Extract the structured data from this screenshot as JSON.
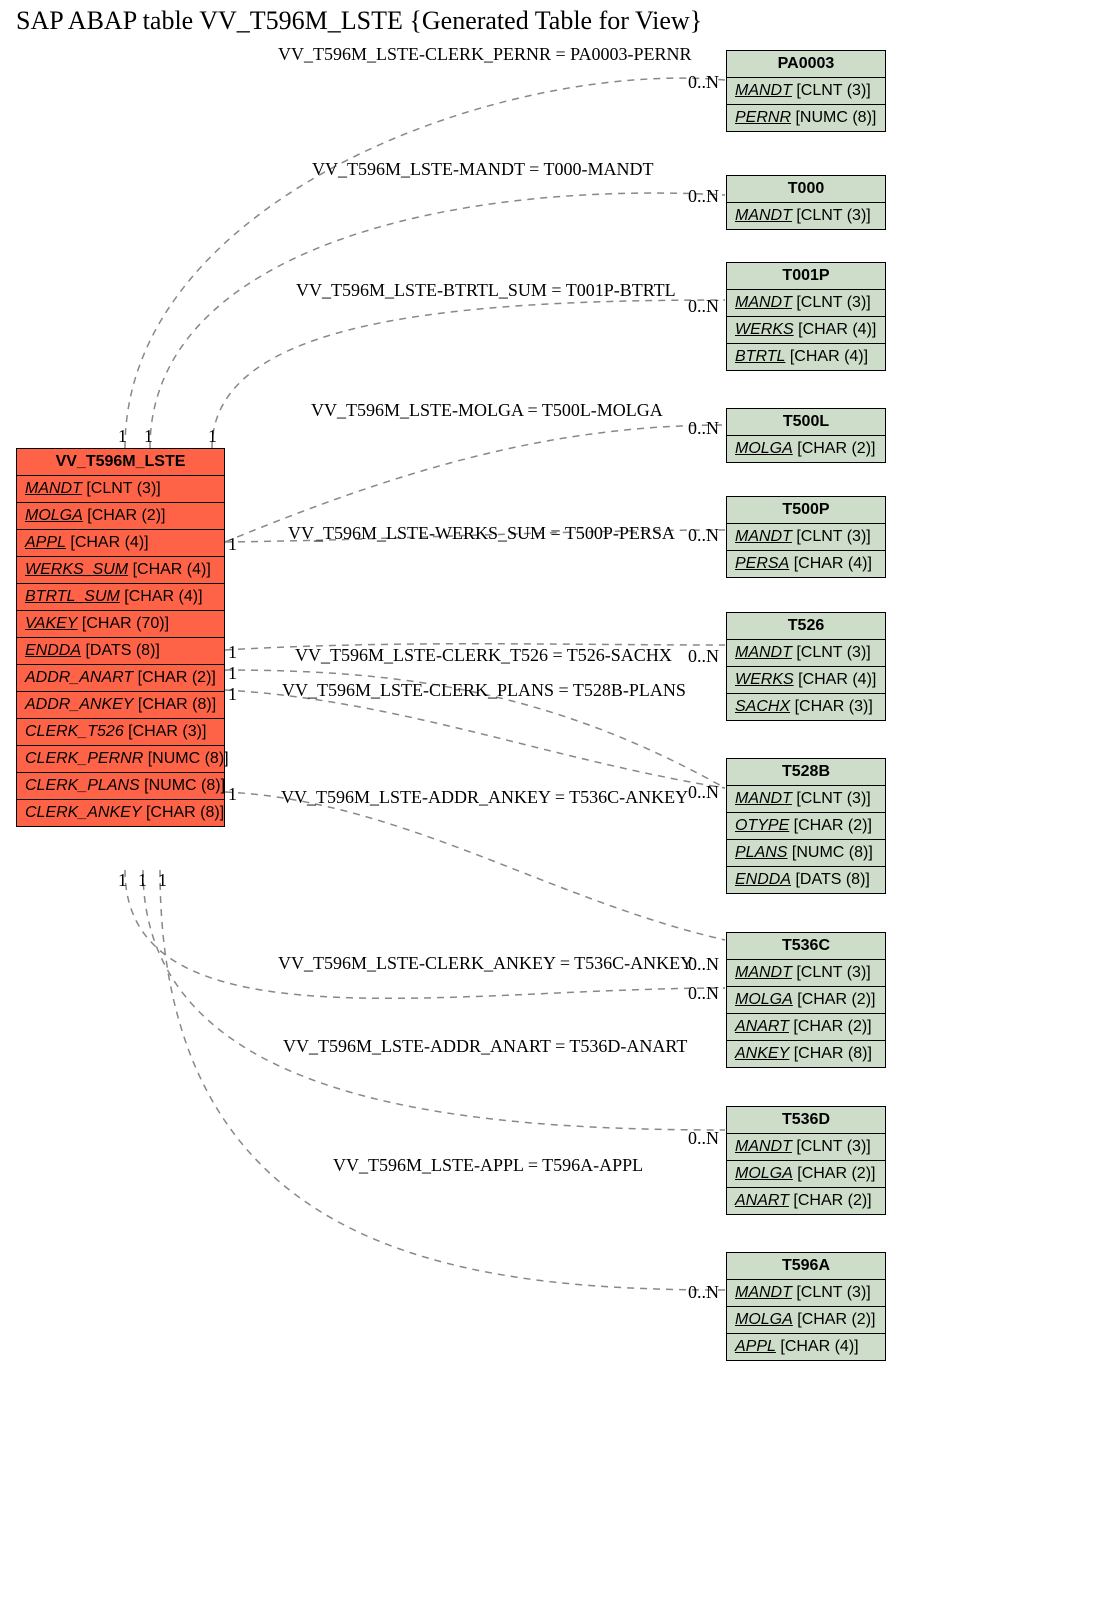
{
  "title": "SAP ABAP table VV_T596M_LSTE {Generated Table for View}",
  "main": {
    "name": "VV_T596M_LSTE",
    "fields": [
      {
        "name": "MANDT",
        "type": "[CLNT (3)]",
        "u": 1
      },
      {
        "name": "MOLGA",
        "type": "[CHAR (2)]",
        "u": 1
      },
      {
        "name": "APPL",
        "type": "[CHAR (4)]",
        "u": 1
      },
      {
        "name": "WERKS_SUM",
        "type": "[CHAR (4)]",
        "u": 1
      },
      {
        "name": "BTRTL_SUM",
        "type": "[CHAR (4)]",
        "u": 1
      },
      {
        "name": "VAKEY",
        "type": "[CHAR (70)]",
        "u": 1
      },
      {
        "name": "ENDDA",
        "type": "[DATS (8)]",
        "u": 1
      },
      {
        "name": "ADDR_ANART",
        "type": "[CHAR (2)]"
      },
      {
        "name": "ADDR_ANKEY",
        "type": "[CHAR (8)]"
      },
      {
        "name": "CLERK_T526",
        "type": "[CHAR (3)]"
      },
      {
        "name": "CLERK_PERNR",
        "type": "[NUMC (8)]"
      },
      {
        "name": "CLERK_PLANS",
        "type": "[NUMC (8)]"
      },
      {
        "name": "CLERK_ANKEY",
        "type": "[CHAR (8)]"
      }
    ]
  },
  "rels": [
    {
      "name": "PA0003",
      "fields": [
        {
          "name": "MANDT",
          "type": "[CLNT (3)]",
          "u": 1
        },
        {
          "name": "PERNR",
          "type": "[NUMC (8)]",
          "u": 1
        }
      ]
    },
    {
      "name": "T000",
      "fields": [
        {
          "name": "MANDT",
          "type": "[CLNT (3)]",
          "u": 1
        }
      ]
    },
    {
      "name": "T001P",
      "fields": [
        {
          "name": "MANDT",
          "type": "[CLNT (3)]",
          "u": 1
        },
        {
          "name": "WERKS",
          "type": "[CHAR (4)]",
          "u": 1
        },
        {
          "name": "BTRTL",
          "type": "[CHAR (4)]",
          "u": 1
        }
      ]
    },
    {
      "name": "T500L",
      "fields": [
        {
          "name": "MOLGA",
          "type": "[CHAR (2)]",
          "u": 1
        }
      ]
    },
    {
      "name": "T500P",
      "fields": [
        {
          "name": "MANDT",
          "type": "[CLNT (3)]",
          "u": 1
        },
        {
          "name": "PERSA",
          "type": "[CHAR (4)]",
          "u": 1
        }
      ]
    },
    {
      "name": "T526",
      "fields": [
        {
          "name": "MANDT",
          "type": "[CLNT (3)]",
          "u": 1
        },
        {
          "name": "WERKS",
          "type": "[CHAR (4)]",
          "u": 1
        },
        {
          "name": "SACHX",
          "type": "[CHAR (3)]",
          "u": 1
        }
      ]
    },
    {
      "name": "T528B",
      "fields": [
        {
          "name": "MANDT",
          "type": "[CLNT (3)]",
          "u": 1
        },
        {
          "name": "OTYPE",
          "type": "[CHAR (2)]",
          "u": 1
        },
        {
          "name": "PLANS",
          "type": "[NUMC (8)]",
          "u": 1
        },
        {
          "name": "ENDDA",
          "type": "[DATS (8)]",
          "u": 1
        }
      ]
    },
    {
      "name": "T536C",
      "fields": [
        {
          "name": "MANDT",
          "type": "[CLNT (3)]",
          "u": 1
        },
        {
          "name": "MOLGA",
          "type": "[CHAR (2)]",
          "u": 1
        },
        {
          "name": "ANART",
          "type": "[CHAR (2)]",
          "u": 1
        },
        {
          "name": "ANKEY",
          "type": "[CHAR (8)]",
          "u": 1
        }
      ]
    },
    {
      "name": "T536D",
      "fields": [
        {
          "name": "MANDT",
          "type": "[CLNT (3)]",
          "u": 1
        },
        {
          "name": "MOLGA",
          "type": "[CHAR (2)]",
          "u": 1
        },
        {
          "name": "ANART",
          "type": "[CHAR (2)]",
          "u": 1
        }
      ]
    },
    {
      "name": "T596A",
      "fields": [
        {
          "name": "MANDT",
          "type": "[CLNT (3)]",
          "u": 1
        },
        {
          "name": "MOLGA",
          "type": "[CHAR (2)]",
          "u": 1
        },
        {
          "name": "APPL",
          "type": "[CHAR (4)]",
          "u": 1
        }
      ]
    }
  ],
  "links": [
    {
      "text": "VV_T596M_LSTE-CLERK_PERNR = PA0003-PERNR",
      "card": "0..N"
    },
    {
      "text": "VV_T596M_LSTE-MANDT = T000-MANDT",
      "card": "0..N"
    },
    {
      "text": "VV_T596M_LSTE-BTRTL_SUM = T001P-BTRTL",
      "card": "0..N"
    },
    {
      "text": "VV_T596M_LSTE-MOLGA = T500L-MOLGA",
      "card": "0..N"
    },
    {
      "text": "VV_T596M_LSTE-WERKS_SUM = T500P-PERSA",
      "card": "0..N"
    },
    {
      "text": "VV_T596M_LSTE-CLERK_T526 = T526-SACHX",
      "card": "0..N"
    },
    {
      "text": "VV_T596M_LSTE-CLERK_PLANS = T528B-PLANS",
      "card": "0..N"
    },
    {
      "text": "VV_T596M_LSTE-ADDR_ANKEY = T536C-ANKEY",
      "card": "0..N"
    },
    {
      "text": "VV_T596M_LSTE-CLERK_ANKEY = T536C-ANKEY",
      "card": "0..N"
    },
    {
      "text": "VV_T596M_LSTE-ADDR_ANART = T536D-ANART",
      "card": "0..N"
    },
    {
      "text": "VV_T596M_LSTE-APPL = T596A-APPL",
      "card": "0..N"
    }
  ],
  "one": "1"
}
